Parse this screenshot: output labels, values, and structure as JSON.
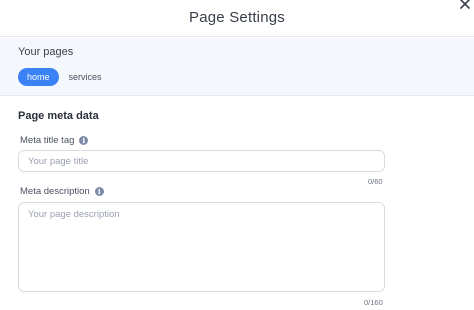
{
  "header": {
    "title": "Page Settings"
  },
  "pages": {
    "label": "Your pages",
    "tabs": [
      {
        "label": "home",
        "active": true
      },
      {
        "label": "services",
        "active": false
      }
    ]
  },
  "meta": {
    "section_title": "Page meta data",
    "title_field": {
      "label": "Meta title tag",
      "placeholder": "Your page title",
      "value": "",
      "counter": "0/60"
    },
    "description_field": {
      "label": "Meta description",
      "placeholder": "Your page description",
      "value": "",
      "counter": "0/160"
    }
  },
  "colors": {
    "accent": "#3b82f6",
    "panel_bg": "#f4f8fd",
    "border": "#d6dbe4"
  },
  "icons": {
    "close": "close-icon",
    "info": "info-icon"
  }
}
